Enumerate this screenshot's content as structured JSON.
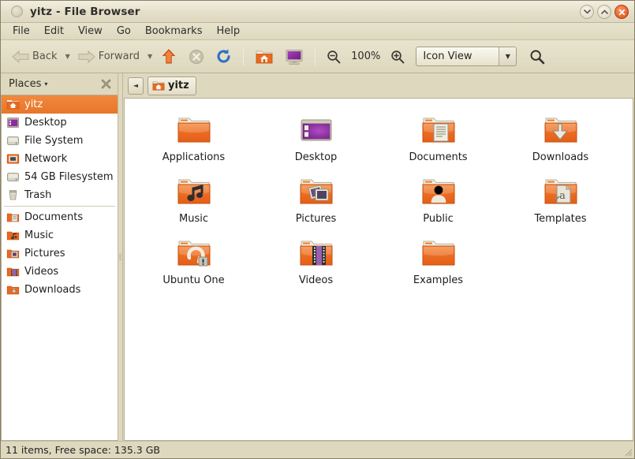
{
  "window": {
    "title": "yitz - File Browser",
    "controls": {
      "menu": "window-menu",
      "minimize": "Minimize",
      "maximize": "Maximize",
      "close": "Close"
    }
  },
  "menubar": {
    "items": [
      {
        "label": "File"
      },
      {
        "label": "Edit"
      },
      {
        "label": "View"
      },
      {
        "label": "Go"
      },
      {
        "label": "Bookmarks"
      },
      {
        "label": "Help"
      }
    ]
  },
  "toolbar": {
    "back_label": "Back",
    "forward_label": "Forward",
    "back_arrow": "▼",
    "forward_arrow": "▼",
    "up_icon": "up-arrow-icon",
    "stop_icon": "stop-icon",
    "reload_icon": "reload-icon",
    "home_icon": "home-folder-icon",
    "computer_icon": "computer-icon",
    "zoom_out_icon": "zoom-out-icon",
    "zoom_level": "100%",
    "zoom_in_icon": "zoom-in-icon",
    "view_mode": "Icon View",
    "view_mode_arrow": "▼",
    "search_icon": "search-icon"
  },
  "sidebar": {
    "header": "Places",
    "header_caret": "▾",
    "close_icon": "close-sidebar-icon",
    "items": [
      {
        "label": "yitz",
        "icon": "home-folder-icon",
        "selected": true
      },
      {
        "label": "Desktop",
        "icon": "desktop-icon",
        "selected": false
      },
      {
        "label": "File System",
        "icon": "harddisk-icon",
        "selected": false
      },
      {
        "label": "Network",
        "icon": "network-icon",
        "selected": false
      },
      {
        "label": "54 GB Filesystem",
        "icon": "harddisk-icon",
        "selected": false
      },
      {
        "label": "Trash",
        "icon": "trash-icon",
        "selected": false
      },
      {
        "label": "Documents",
        "icon": "documents-folder-icon",
        "selected": false
      },
      {
        "label": "Music",
        "icon": "music-folder-icon",
        "selected": false
      },
      {
        "label": "Pictures",
        "icon": "pictures-folder-icon",
        "selected": false
      },
      {
        "label": "Videos",
        "icon": "videos-folder-icon",
        "selected": false
      },
      {
        "label": "Downloads",
        "icon": "downloads-folder-icon",
        "selected": false
      }
    ],
    "separator_after_index": 5
  },
  "pathbar": {
    "scroll_left_icon": "◄",
    "current": "yitz",
    "current_icon": "home-folder-icon"
  },
  "files": [
    {
      "label": "Applications",
      "icon": "folder-plain"
    },
    {
      "label": "Desktop",
      "icon": "desktop-window"
    },
    {
      "label": "Documents",
      "icon": "folder-documents"
    },
    {
      "label": "Downloads",
      "icon": "folder-downloads"
    },
    {
      "label": "Music",
      "icon": "folder-music"
    },
    {
      "label": "Pictures",
      "icon": "folder-pictures"
    },
    {
      "label": "Public",
      "icon": "folder-public"
    },
    {
      "label": "Templates",
      "icon": "folder-templates"
    },
    {
      "label": "Ubuntu One",
      "icon": "folder-ubuntuone"
    },
    {
      "label": "Videos",
      "icon": "folder-videos"
    },
    {
      "label": "Examples",
      "icon": "folder-plain"
    }
  ],
  "statusbar": {
    "text": "11 items, Free space: 135.3 GB"
  },
  "colors": {
    "chrome": "#ded8bf",
    "selection": "#e8762a",
    "folder_orange": "#ea6a21",
    "close_button": "#df4b16",
    "desktop_purple": "#7b2e8e"
  }
}
